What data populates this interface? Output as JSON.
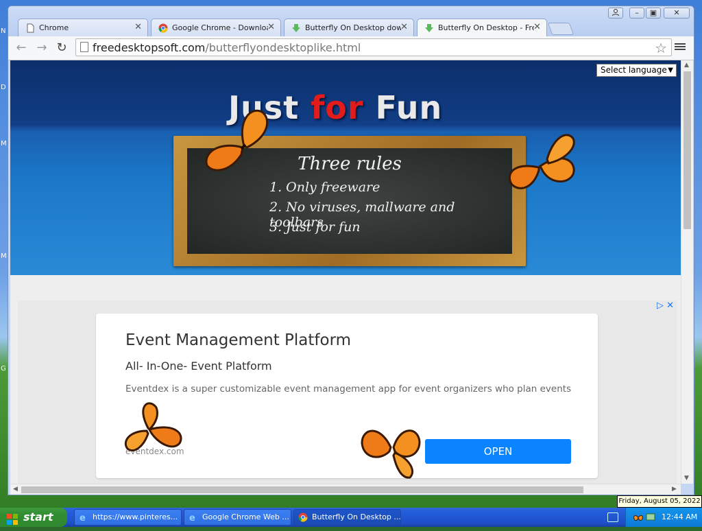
{
  "desktop": {
    "edge_letters": [
      "N",
      "D",
      "M",
      "M",
      "G"
    ]
  },
  "browser": {
    "tabs": [
      {
        "label": "Chrome",
        "icon": "page-icon",
        "active": false
      },
      {
        "label": "Google Chrome - Download t",
        "icon": "chrome-logo-icon",
        "active": false
      },
      {
        "label": "Butterfly On Desktop downlo",
        "icon": "download-arrow-icon",
        "active": false
      },
      {
        "label": "Butterfly On Desktop - Freew",
        "icon": "download-arrow-icon",
        "active": true
      }
    ],
    "url_domain": "freedesktopsoft.com",
    "url_path": "/butterflyondesktoplike.html"
  },
  "page": {
    "language_select": "Select language",
    "logo": {
      "part1": "Just ",
      "part2": "for",
      "part3": " Fun"
    },
    "board": {
      "title": "Three rules",
      "rules": [
        "1. Only freeware",
        "2. No viruses, mallware and toolbars",
        "3. Just for fun"
      ]
    },
    "ad": {
      "title": "Event Management Platform",
      "subtitle": "All- In-One- Event Platform",
      "description": "Eventdex is a super customizable event management app for event organizers who plan events",
      "domain": "eventdex.com",
      "button": "OPEN"
    }
  },
  "taskbar": {
    "start_label": "start",
    "tasks": [
      {
        "label": "https://www.pinteres...",
        "icon": "ie-icon"
      },
      {
        "label": "Google Chrome Web ...",
        "icon": "ie-icon"
      },
      {
        "label": "Butterfly On Desktop ...",
        "icon": "chrome-logo-icon"
      }
    ],
    "clock": "12:44 AM",
    "date_tooltip": "Friday, August 05, 2022"
  },
  "colors": {
    "logo_accent": "#e21b1b",
    "ad_button": "#0a84ff",
    "start_button": "#318b31"
  }
}
